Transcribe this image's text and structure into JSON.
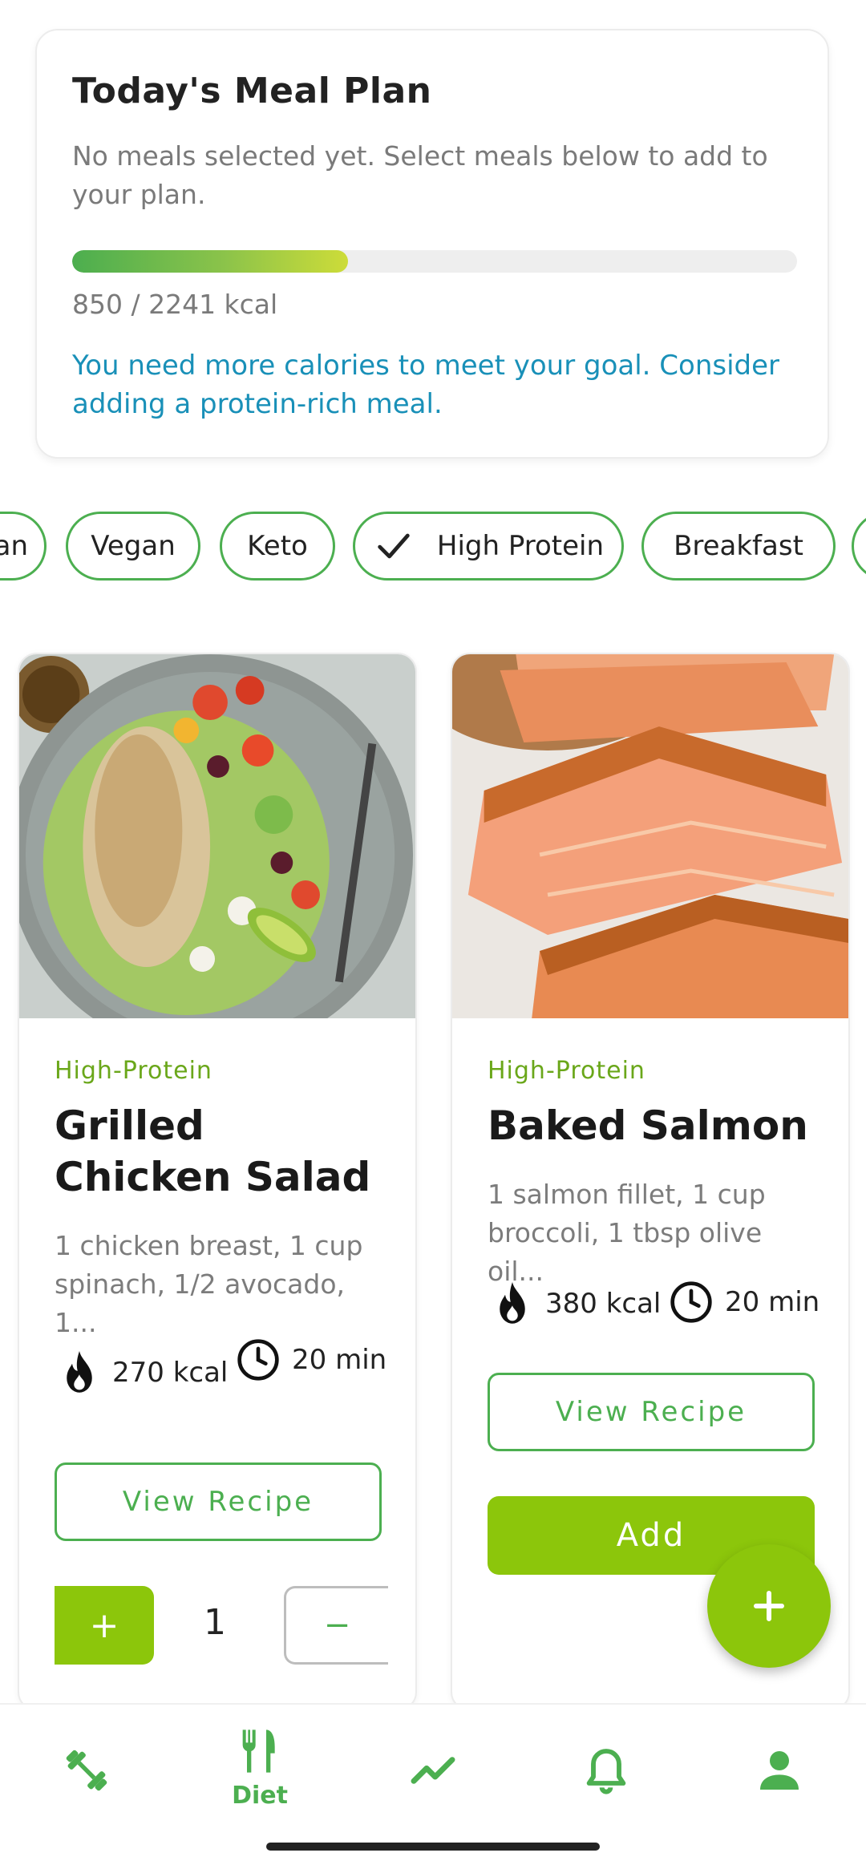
{
  "plan": {
    "title": "Today's Meal Plan",
    "subtitle": "No meals selected yet. Select meals below to add to your plan.",
    "progress_fraction": 0.38,
    "kcal_text": "850 / 2241 kcal",
    "hint": "You need more calories to meet your goal. Consider adding a protein-rich meal."
  },
  "filters": [
    {
      "label": "an",
      "selected": false
    },
    {
      "label": "Vegan",
      "selected": false
    },
    {
      "label": "Keto",
      "selected": false
    },
    {
      "label": "High Protein",
      "selected": true
    },
    {
      "label": "Breakfast",
      "selected": false
    }
  ],
  "meals": [
    {
      "tag": "High-Protein",
      "name": "Grilled Chicken Salad",
      "ingredients": "1 chicken breast, 1 cup spinach, 1/2 avocado, 1...",
      "kcal": "270 kcal",
      "time": "20 min",
      "view_label": "View Recipe",
      "qty_plus": "+",
      "qty_value": "1",
      "qty_minus": "−"
    },
    {
      "tag": "High-Protein",
      "name": "Baked Salmon",
      "ingredients": "1 salmon fillet, 1 cup broccoli, 1 tbsp olive oil...",
      "kcal": "380 kcal",
      "time": "20 min",
      "view_label": "View Recipe",
      "add_label": "Add"
    }
  ],
  "fab": {
    "icon": "plus-icon"
  },
  "nav": {
    "items": [
      {
        "icon": "dumbbell-icon",
        "label": ""
      },
      {
        "icon": "fork-knife-icon",
        "label": "Diet"
      },
      {
        "icon": "trend-icon",
        "label": ""
      },
      {
        "icon": "bell-icon",
        "label": ""
      },
      {
        "icon": "person-icon",
        "label": ""
      }
    ]
  },
  "colors": {
    "accent": "#4caf50",
    "lime": "#8cc60b",
    "hint": "#1990b8"
  }
}
